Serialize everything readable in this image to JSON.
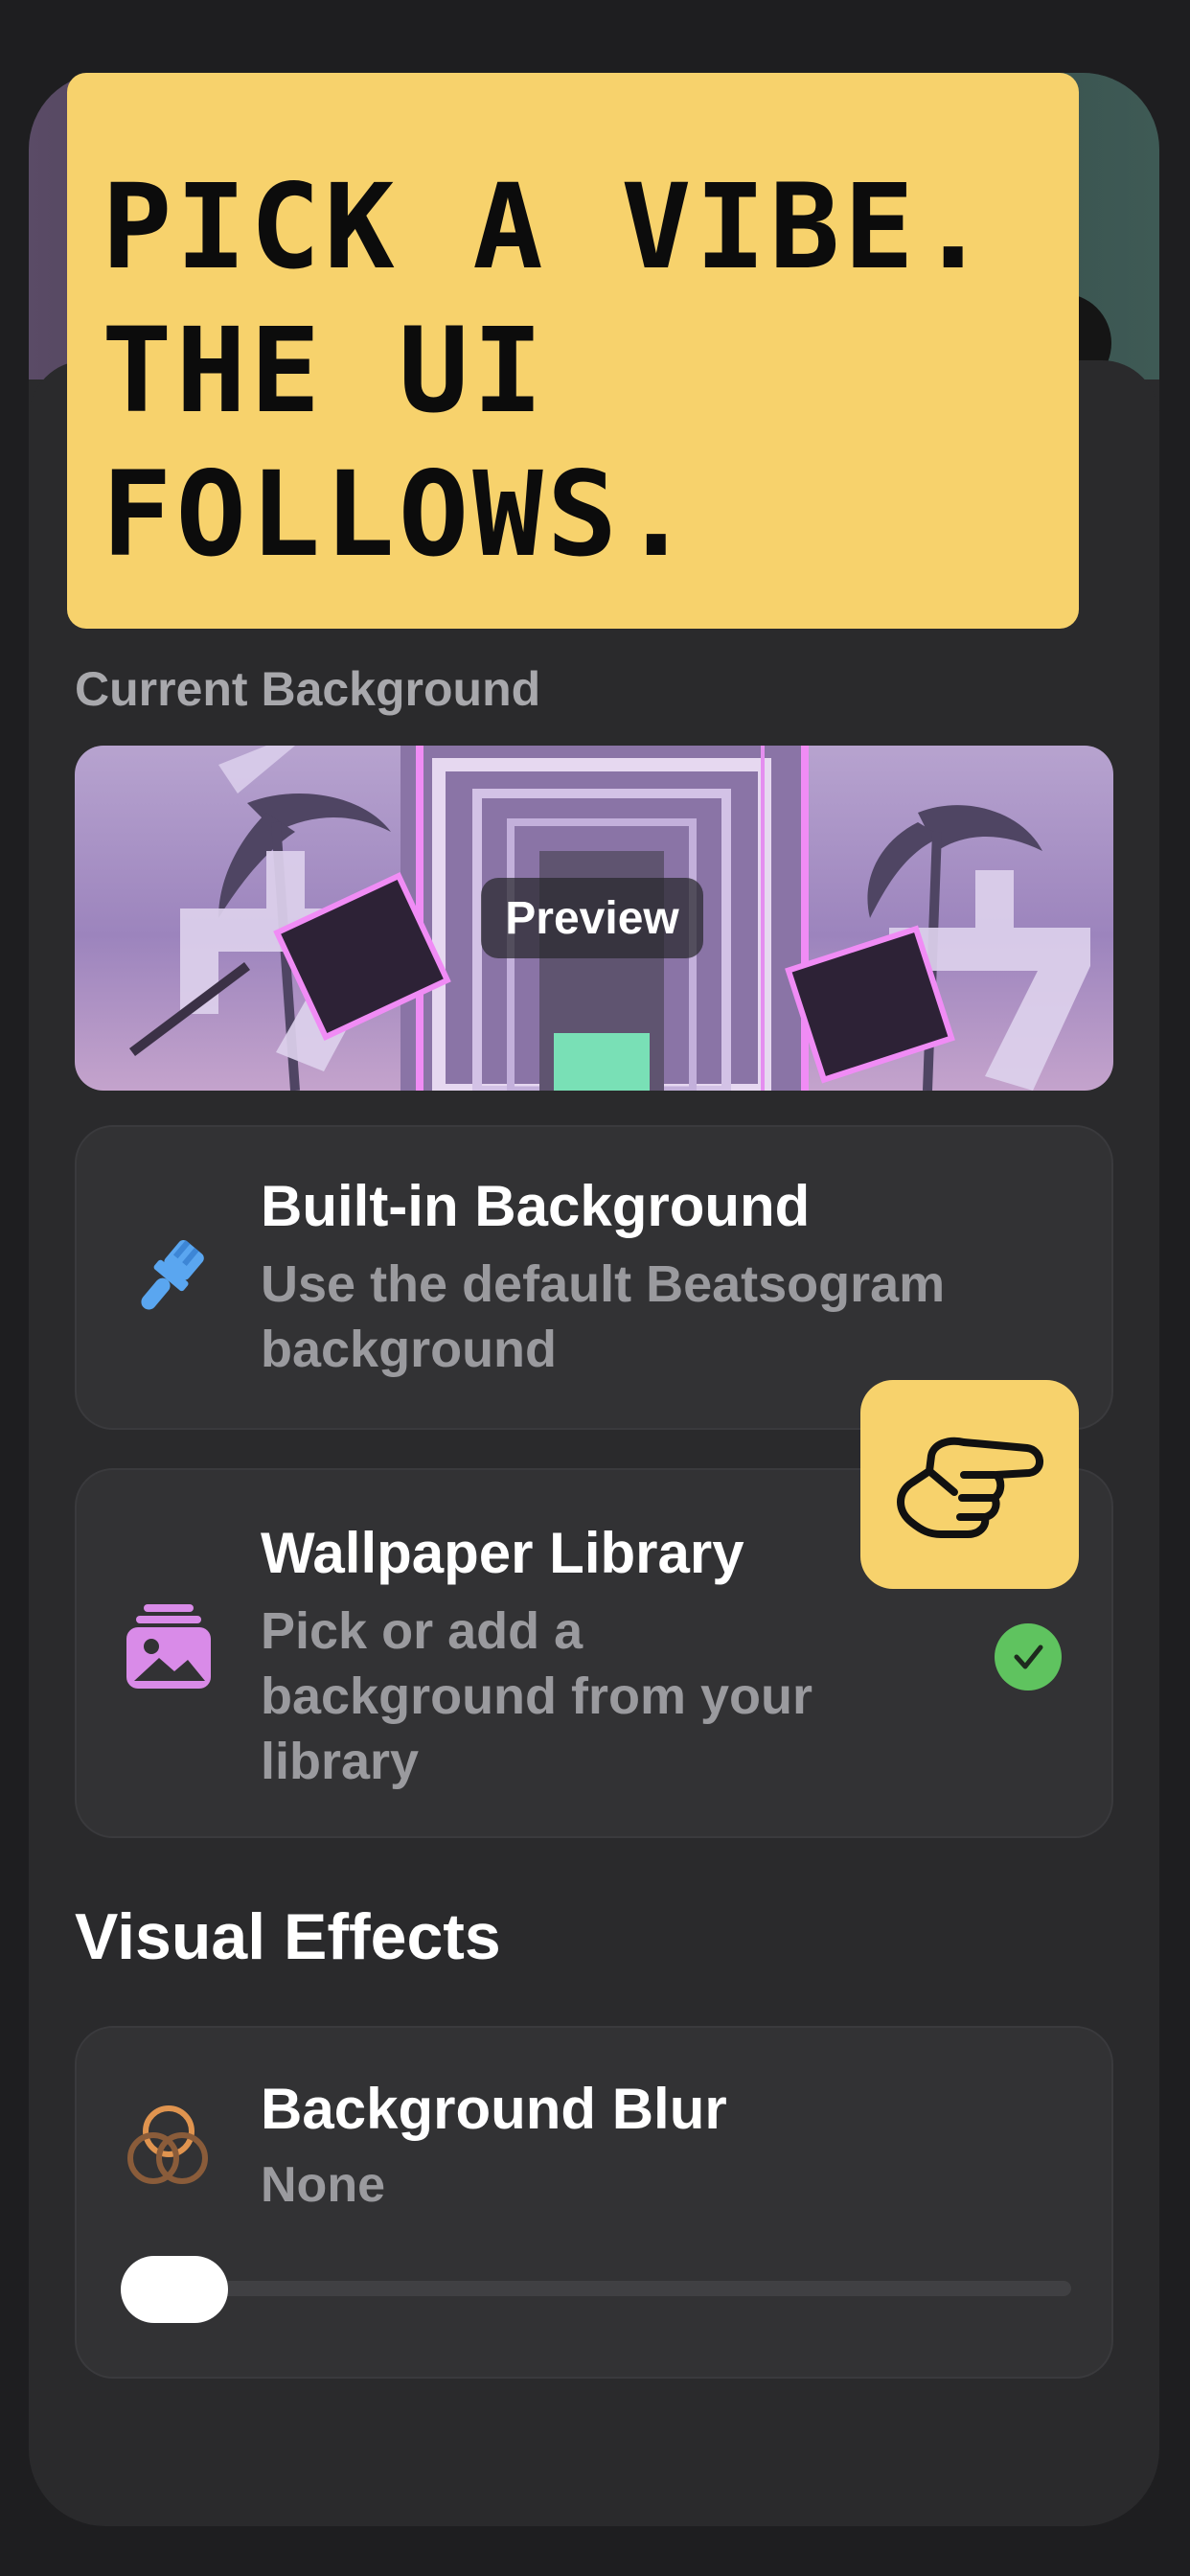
{
  "headline": {
    "lines": [
      "PICK A VIBE.",
      "THE UI",
      "FOLLOWS."
    ]
  },
  "current_background": {
    "label": "Current Background",
    "preview_label": "Preview"
  },
  "options": {
    "builtin": {
      "title": "Built-in Background",
      "description": "Use the default Beatsogram background",
      "icon": "paintbrush-icon",
      "selected": false
    },
    "library": {
      "title": "Wallpaper Library",
      "description": "Pick or add a background from your library",
      "icon": "photo-stack-icon",
      "selected": true
    }
  },
  "visual_effects": {
    "title": "Visual Effects",
    "blur": {
      "title": "Background Blur",
      "value_label": "None",
      "icon": "blur-circles-icon",
      "level": 0
    }
  },
  "colors": {
    "accent_yellow": "#f7d26c",
    "check_green": "#5fc35f",
    "brush_blue": "#5aa6f0",
    "photo_pink": "#d98be8",
    "blur_orange": "#e0944f"
  }
}
